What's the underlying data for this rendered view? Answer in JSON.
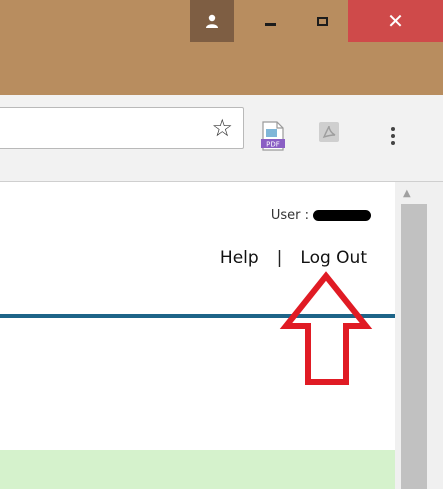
{
  "window_controls": {
    "close_glyph": "✕"
  },
  "toolbar": {
    "bookmark_icon": "star-icon",
    "extension_pdf_label": "PDF",
    "menu_icon": "vertical-dots-icon"
  },
  "page": {
    "user_label": "User :",
    "help_link": "Help",
    "separator": "|",
    "logout_link": "Log Out"
  },
  "colors": {
    "titlebar": "#b88d5f",
    "close_button": "#cf4a4a",
    "rule": "#1d6488",
    "green_band": "#d5f2cc",
    "annotation_arrow": "#e01b24"
  }
}
